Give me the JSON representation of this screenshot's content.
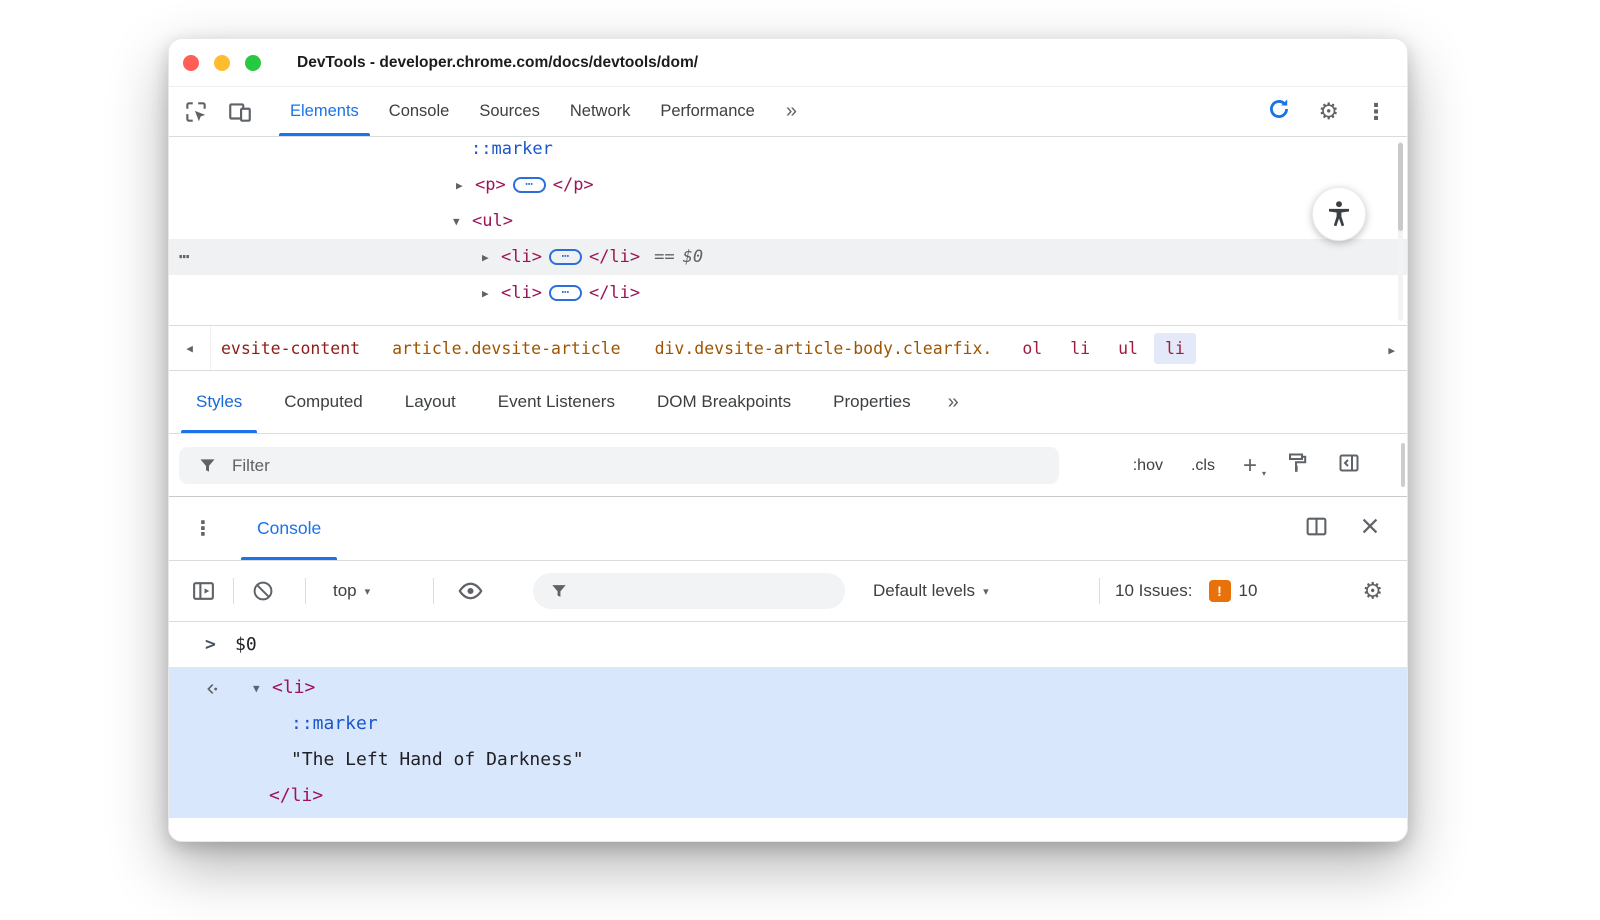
{
  "titlebar": {
    "title": "DevTools - developer.chrome.com/docs/devtools/dom/"
  },
  "icons": {
    "tri_collapsed": "▶",
    "tri_expanded": "▼",
    "caret_down": "▾",
    "kebab": "⋮",
    "gear": "⚙",
    "more_chevrons": "»",
    "crumb_left": "◀",
    "crumb_right": "▶",
    "pill_dots": "⋯",
    "overflow_dots": "⋯",
    "issue_badge_glyph": "!"
  },
  "main_toolbar": {
    "tabs": [
      {
        "label": "Elements",
        "active": true
      },
      {
        "label": "Console"
      },
      {
        "label": "Sources"
      },
      {
        "label": "Network"
      },
      {
        "label": "Performance"
      }
    ]
  },
  "elements_tree": {
    "rows": [
      {
        "pseudo": "::marker"
      },
      {
        "open": "<p>",
        "close": "</p>"
      },
      {
        "open": "<ul>"
      },
      {
        "open": "<li>",
        "close": "</li>",
        "eq": "==",
        "eq_value": "$0",
        "selected": true
      },
      {
        "open": "<li>",
        "close": "</li>"
      }
    ]
  },
  "breadcrumbs": {
    "items": [
      {
        "label": "evsite-content",
        "color": "#8c1d18"
      },
      {
        "label": "article.devsite-article",
        "color": "#9e5400"
      },
      {
        "label": "div.devsite-article-body.clearfix.",
        "color": "#9e5400"
      },
      {
        "label": "ol",
        "color": "#a11c3c"
      },
      {
        "label": "li",
        "color": "#a11c3c"
      },
      {
        "label": "ul",
        "color": "#a11c3c"
      },
      {
        "label": "li",
        "color": "#a11c3c",
        "selected": true
      }
    ]
  },
  "styles_panel": {
    "tabs": [
      {
        "label": "Styles",
        "active": true
      },
      {
        "label": "Computed"
      },
      {
        "label": "Layout"
      },
      {
        "label": "Event Listeners"
      },
      {
        "label": "DOM Breakpoints"
      },
      {
        "label": "Properties"
      }
    ],
    "filter": {
      "placeholder": "Filter"
    },
    "toggles": {
      "hov": ":hov",
      "cls": ".cls",
      "plus": "+"
    }
  },
  "console": {
    "tab": "Console",
    "context": "top",
    "levels": "Default levels",
    "issues": {
      "label": "10 Issues:",
      "count": "10"
    },
    "prompt": {
      "chevron": ">",
      "value": "$0"
    },
    "result": {
      "open": "<li>",
      "pseudo": "::marker",
      "string": "\"The Left Hand of Darkness\"",
      "close": "</li>"
    }
  },
  "colors": {
    "accent_blue": "#1a73e8",
    "tag_color": "#9c1457",
    "pseudo_blue": "#1a56c9",
    "selected_row_gray": "#f0f1f2",
    "console_highlight": "#d9e7fd",
    "issues_orange": "#e8710a",
    "traffic_close": "#ff5f57",
    "traffic_minimize": "#febc2e",
    "traffic_zoom": "#28c840"
  }
}
